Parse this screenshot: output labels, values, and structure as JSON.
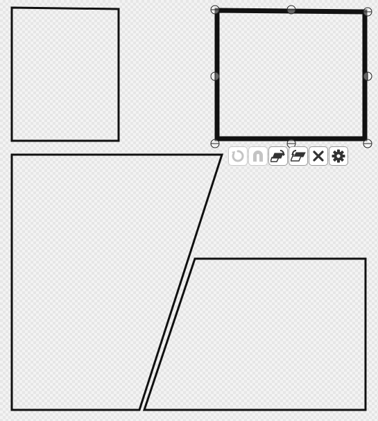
{
  "app": {
    "name": "panel-layout-editor"
  },
  "canvas": {
    "background": "#f3f3f3",
    "checker_color": "#e6e6e6",
    "panel_stroke_color": "#111111",
    "panels": [
      {
        "id": "panel-1",
        "shape": "rectangle",
        "selected": false
      },
      {
        "id": "panel-2",
        "shape": "rectangle",
        "selected": true
      },
      {
        "id": "panel-3",
        "shape": "trapezoid",
        "selected": false
      },
      {
        "id": "panel-4",
        "shape": "trapezoid",
        "selected": false
      }
    ],
    "selection": {
      "panel": "panel-2",
      "handle_count": 8
    }
  },
  "toolbar": {
    "buttons": [
      {
        "id": "rotate",
        "icon": "rotate-icon",
        "enabled": false
      },
      {
        "id": "flip",
        "icon": "flip-icon",
        "enabled": false
      },
      {
        "id": "bring-forward",
        "icon": "bring-forward-icon",
        "enabled": true
      },
      {
        "id": "send-backward",
        "icon": "send-backward-icon",
        "enabled": true
      },
      {
        "id": "delete",
        "icon": "close-icon",
        "enabled": true
      },
      {
        "id": "settings",
        "icon": "gear-icon",
        "enabled": true
      }
    ],
    "icon_color": "#333333",
    "disabled_icon_color": "#c4c4c4"
  }
}
